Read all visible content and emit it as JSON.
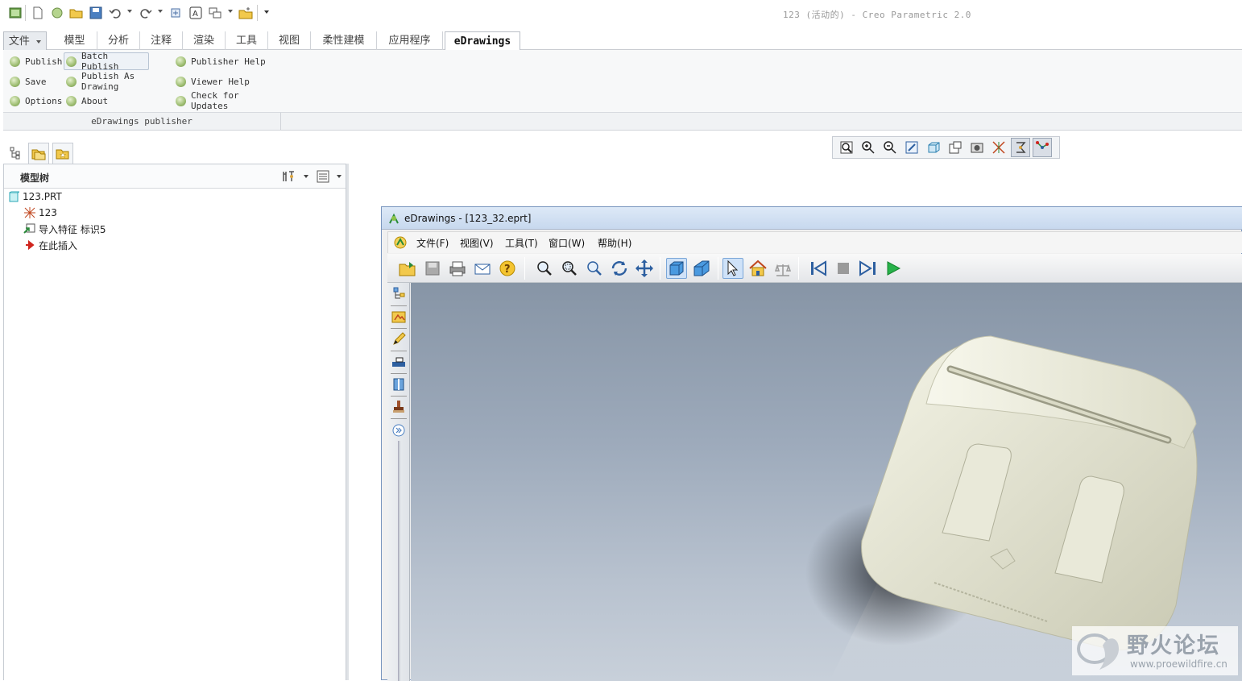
{
  "window": {
    "title": "123 (活动的) - Creo Parametric 2.0"
  },
  "quick_access": [
    "new-icon",
    "open-icon",
    "save-icon",
    "undo-icon",
    "redo-icon",
    "regenerate-icon",
    "window-icon",
    "close-icon",
    "customize-icon"
  ],
  "tabs": {
    "file": "文件",
    "items": [
      "模型",
      "分析",
      "注释",
      "渲染",
      "工具",
      "视图",
      "柔性建模",
      "应用程序"
    ],
    "active": "eDrawings"
  },
  "ribbon": {
    "buttons": {
      "publish": "Publish",
      "batch_publish": "Batch Publish",
      "publisher_help": "Publisher Help",
      "save": "Save",
      "publish_as_drawing": "Publish As Drawing",
      "viewer_help": "Viewer Help",
      "options": "Options",
      "about": "About",
      "check_updates": "Check for Updates"
    },
    "group_label": "eDrawings publisher"
  },
  "model_tree": {
    "header": "模型树",
    "items": [
      {
        "label": "123.PRT"
      },
      {
        "label": "123"
      },
      {
        "label": "导入特征 标识5"
      },
      {
        "label": "在此插入"
      }
    ]
  },
  "edrawings": {
    "title": "eDrawings - [123_32.eprt]",
    "menu": [
      "文件(F)",
      "视图(V)",
      "工具(T)",
      "窗口(W)",
      "帮助(H)"
    ]
  },
  "watermark": {
    "title": "野火论坛",
    "url": "www.proewildfire.cn"
  },
  "colors": {
    "accent": "#9cbc70",
    "titlebar": "#c7d8ee",
    "viewport": "#9daabb",
    "model": "#e9e9d9"
  }
}
